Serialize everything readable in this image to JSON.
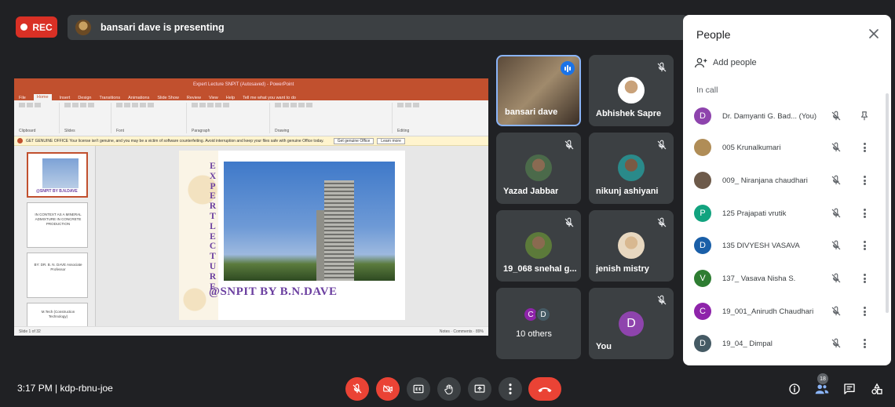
{
  "top": {
    "rec_label": "REC",
    "presenting_text": "bansari dave is presenting"
  },
  "ppt": {
    "window_title": "Expert Lecture SNPIT (Autosaved) - PowerPoint",
    "tabs": [
      "File",
      "Home",
      "Insert",
      "Design",
      "Transitions",
      "Animations",
      "Slide Show",
      "Review",
      "View",
      "Help",
      "Tell me what you want to do"
    ],
    "ribbon_groups": [
      "Clipboard",
      "Slides",
      "Font",
      "Paragraph",
      "Drawing",
      "Editing"
    ],
    "warning_text": "GET GENUINE OFFICE  Your license isn't genuine, and you may be a victim of software counterfeiting. Avoid interruption and keep your files safe with genuine Office today.",
    "warning_btn1": "Get genuine Office",
    "warning_btn2": "Learn more",
    "thumb_nums": [
      "1",
      "2",
      "3",
      "4"
    ],
    "thumb1_caption": "@SNPIT BY B.N.DAVE",
    "thumb2_text": "IN CONTEXT AS A MINERAL ADMIXTURE IN CONCRETE PRODUCTION",
    "thumb3_text": "BY: DR. B. N. DAVE Associate Professor",
    "thumb4_text": "M.Tech (Construction Technology)",
    "slide_vertical": "EXPERTLECTURE",
    "slide_byline": "@SNPIT BY B.N.DAVE",
    "status_left": "Slide 1 of 32",
    "status_notes": "Notes",
    "status_comments": "Comments",
    "status_zoom": "89%"
  },
  "tiles": [
    {
      "name": "bansari dave",
      "speaking": true
    },
    {
      "name": "Abhishek Sapre",
      "muted": true
    },
    {
      "name": "Yazad Jabbar",
      "muted": true
    },
    {
      "name": "nikunj ashiyani",
      "muted": true
    },
    {
      "name": "19_068 snehal g...",
      "muted": true
    },
    {
      "name": "jenish mistry",
      "muted": true
    },
    {
      "name": "10 others",
      "avatars": [
        "C",
        "D"
      ]
    },
    {
      "name": "You",
      "avatar": "D",
      "muted": true
    }
  ],
  "panel": {
    "title": "People",
    "add_people": "Add people",
    "in_call": "In call",
    "people": [
      {
        "name": "Dr. Damyanti G. Bad... (You)",
        "avatar": "D",
        "color": "#8e44ad"
      },
      {
        "name": "005 Krunalkumari",
        "avatar": "",
        "color": "#b08d57"
      },
      {
        "name": "009_ Niranjana chaudhari",
        "avatar": "",
        "color": "#6d5a4a"
      },
      {
        "name": "125 Prajapati vrutik",
        "avatar": "P",
        "color": "#12a37f"
      },
      {
        "name": "135 DIVYESH VASAVA",
        "avatar": "D",
        "color": "#1a5fa8"
      },
      {
        "name": "137_ Vasava Nisha S.",
        "avatar": "V",
        "color": "#2e7d32"
      },
      {
        "name": "19_001_Anirudh Chaudhari",
        "avatar": "C",
        "color": "#8e24aa"
      },
      {
        "name": "19_04_ Dimpal",
        "avatar": "D",
        "color": "#455a64"
      }
    ]
  },
  "bottom": {
    "meeting_info": "3:17 PM  |  kdp-rbnu-joe",
    "participant_count": "18"
  },
  "colors": {
    "background": "#202124",
    "tile": "#3c4043",
    "danger": "#ea4335",
    "accent": "#1a73e8",
    "slide_text": "#6b3fa0"
  }
}
